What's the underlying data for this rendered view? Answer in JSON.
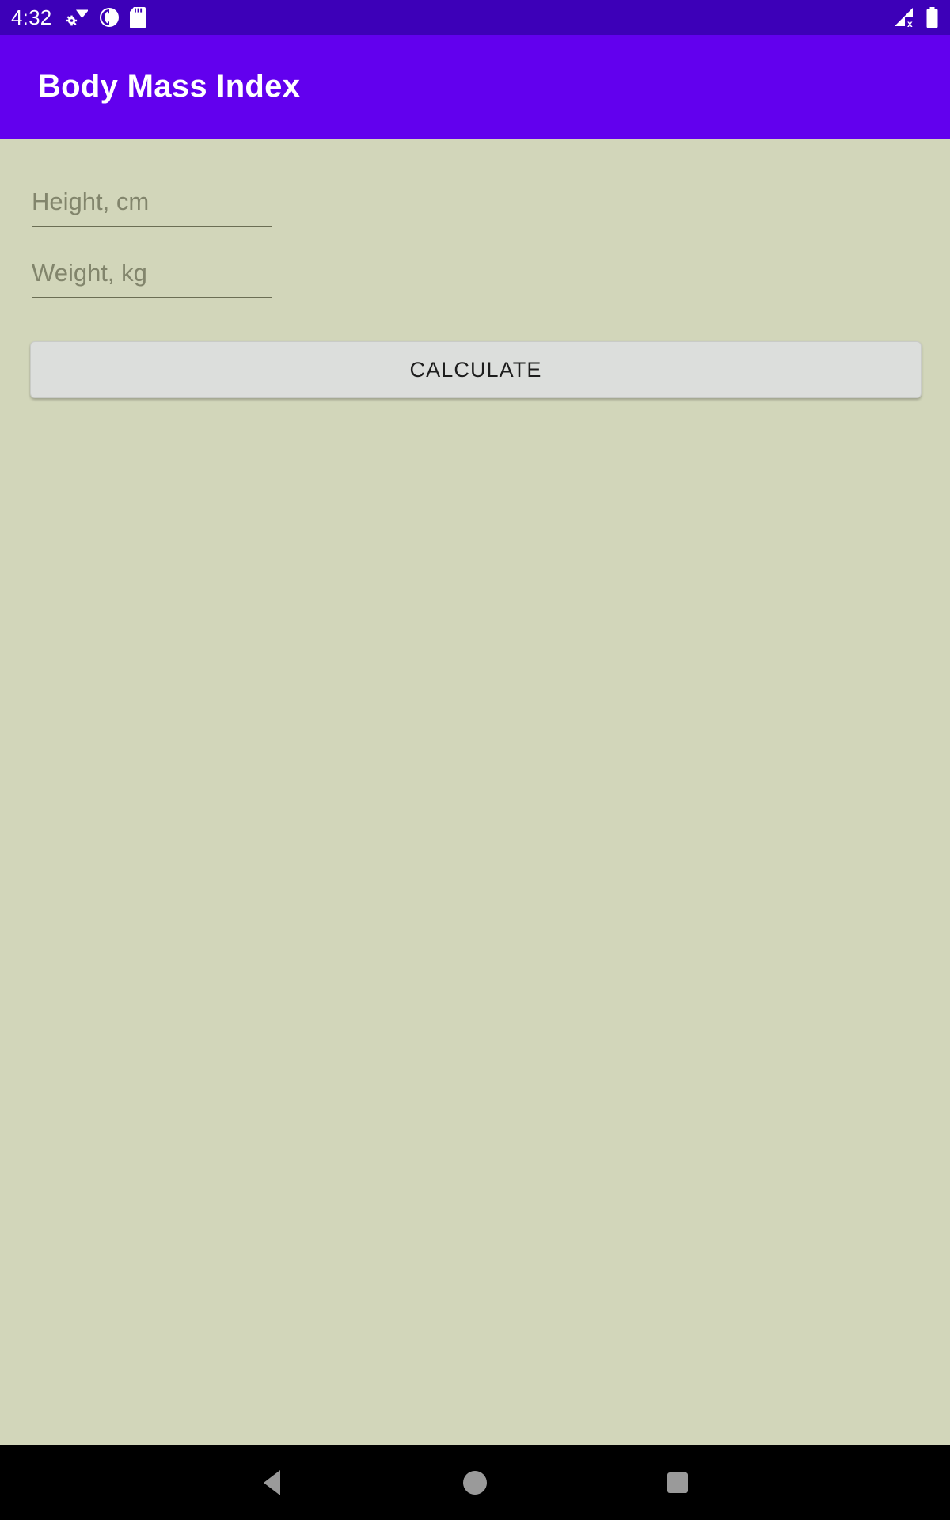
{
  "status_bar": {
    "clock": "4:32",
    "background_color": "#3D00B8",
    "left_icons": [
      {
        "name": "wifi-settings-icon",
        "glyph": "wifi-gear"
      },
      {
        "name": "do-not-disturb-icon",
        "glyph": "circle-half"
      },
      {
        "name": "sd-card-icon",
        "glyph": "sd-card"
      }
    ],
    "right_icons": [
      {
        "name": "cellular-signal-off-icon",
        "glyph": "signal-x"
      },
      {
        "name": "battery-icon",
        "glyph": "battery-full"
      }
    ]
  },
  "app_bar": {
    "title": "Body Mass Index",
    "background_color": "#6200EE",
    "title_color": "#FFFFFF"
  },
  "content": {
    "background_color": "#D2D6BA",
    "fields": [
      {
        "name": "height-input",
        "placeholder": "Height, cm",
        "value": "",
        "underline_color": "#6B6E54"
      },
      {
        "name": "weight-input",
        "placeholder": "Weight, kg",
        "value": "",
        "underline_color": "#6B6E54"
      }
    ],
    "calculate_button": {
      "label": "CALCULATE",
      "background_color": "#DCDEDC",
      "text_color": "#1D1D1D"
    }
  },
  "nav_bar": {
    "background_color": "#000000",
    "icon_color": "#9A9A9A",
    "buttons": [
      {
        "name": "back-button",
        "glyph": "triangle-left"
      },
      {
        "name": "home-button",
        "glyph": "circle"
      },
      {
        "name": "recents-button",
        "glyph": "square"
      }
    ]
  }
}
